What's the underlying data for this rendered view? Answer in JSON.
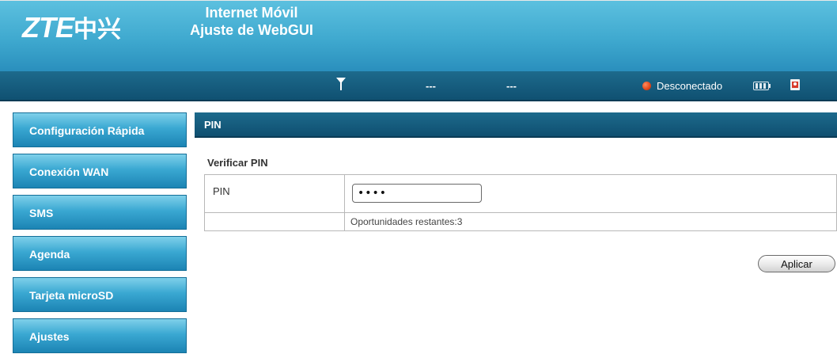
{
  "header": {
    "logo_latin": "ZTE",
    "logo_cjk": "中兴",
    "title_line1": "Internet Móvil",
    "title_line2": "Ajuste de WebGUI"
  },
  "statusbar": {
    "signal_icon": "signal-antenna-icon",
    "network_placeholder": "---",
    "operator_placeholder": "---",
    "connection_status": "Desconectado",
    "connection_color": "#e2471a",
    "battery_icon": "battery-icon",
    "sim_icon": "sim-card-icon"
  },
  "sidebar": {
    "items": [
      {
        "label": "Configuración Rápida"
      },
      {
        "label": "Conexión WAN"
      },
      {
        "label": "SMS"
      },
      {
        "label": "Agenda"
      },
      {
        "label": "Tarjeta microSD"
      },
      {
        "label": "Ajustes"
      }
    ]
  },
  "main": {
    "panel_title": "PIN",
    "section_title": "Verificar PIN",
    "pin_label": "PIN",
    "pin_value": "••••",
    "remaining_attempts": "Oportunidades restantes:3",
    "apply_label": "Aplicar"
  },
  "colors": {
    "header_top": "#5cc0df",
    "bar_dark": "#0f4f70",
    "nav_blue": "#3aa8d2"
  }
}
